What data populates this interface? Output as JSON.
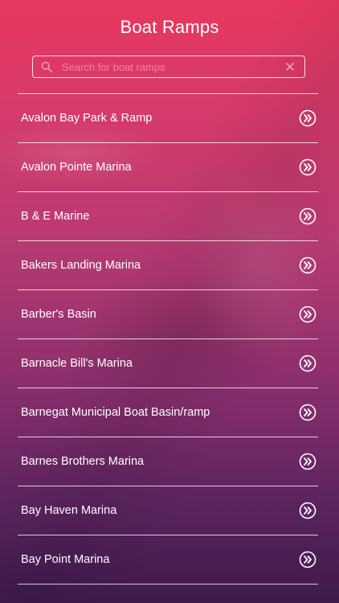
{
  "header": {
    "title": "Boat Ramps"
  },
  "search": {
    "placeholder": "Search for boat ramps",
    "value": ""
  },
  "icons": {
    "search": "search-icon",
    "clear": "close-icon",
    "row_arrow": "double-chevron-right-circle-icon"
  },
  "colors": {
    "gradient_top": "#e8385f",
    "gradient_bottom": "#3e1a4c",
    "text": "#ffffff"
  },
  "list": {
    "items": [
      {
        "label": "Avalon Bay Park & Ramp"
      },
      {
        "label": "Avalon Pointe Marina"
      },
      {
        "label": "B & E Marine"
      },
      {
        "label": "Bakers Landing Marina"
      },
      {
        "label": "Barber's Basin"
      },
      {
        "label": "Barnacle Bill's Marina"
      },
      {
        "label": "Barnegat Municipal Boat Basin/ramp"
      },
      {
        "label": "Barnes Brothers Marina"
      },
      {
        "label": "Bay Haven Marina"
      },
      {
        "label": "Bay Point Marina"
      }
    ]
  }
}
